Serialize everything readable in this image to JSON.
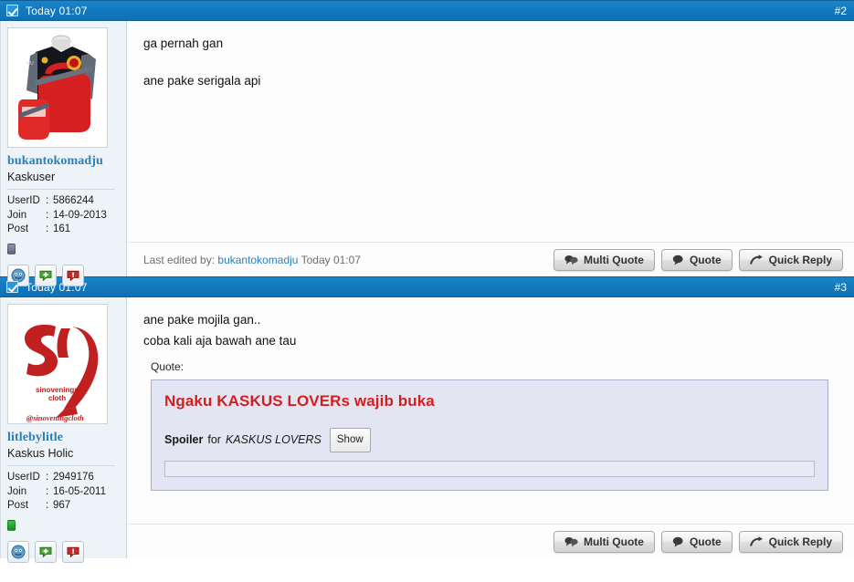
{
  "posts": [
    {
      "header": {
        "date": "Today 01:07",
        "number": "#2",
        "checkbox_icon": "checkbox-checked-icon"
      },
      "user": {
        "name": "bukantokomadju",
        "title": "Kaskuser",
        "avatar_alt": "manchester-united-jacket-avatar",
        "status": "offline",
        "stats": [
          {
            "key": "UserID",
            "sep": ":",
            "value": "5866244"
          },
          {
            "key": "Join",
            "sep": ":",
            "value": "14-09-2013"
          },
          {
            "key": "Post",
            "sep": ":",
            "value": "161"
          }
        ],
        "icons": [
          "profile-icon",
          "reputation-up-icon",
          "report-icon"
        ]
      },
      "body": {
        "lines": [
          "ga pernah gan",
          "ane pake serigala api"
        ]
      },
      "footer": {
        "last_edited_prefix": "Last edited by:",
        "last_edited_user": "bukantokomadju",
        "last_edited_time": "Today 01:07",
        "buttons": [
          {
            "label": "Multi Quote",
            "icon": "multi-quote-icon"
          },
          {
            "label": "Quote",
            "icon": "quote-icon"
          },
          {
            "label": "Quick Reply",
            "icon": "quick-reply-icon"
          }
        ]
      }
    },
    {
      "header": {
        "date": "Today 01:07",
        "number": "#3",
        "checkbox_icon": "checkbox-checked-icon"
      },
      "user": {
        "name": "litlebylitle",
        "title": "Kaskus Holic",
        "avatar_alt": "sin-sinovenings-cloth-logo-avatar",
        "avatar_caption": "sinovenings cloth",
        "avatar_handle": "@sinoveningcloth",
        "avatar_wordmark": "sin",
        "status": "online",
        "stats": [
          {
            "key": "UserID",
            "sep": ":",
            "value": "2949176"
          },
          {
            "key": "Join",
            "sep": ":",
            "value": "16-05-2011"
          },
          {
            "key": "Post",
            "sep": ":",
            "value": "967"
          }
        ],
        "icons": [
          "profile-icon",
          "reputation-up-icon",
          "report-icon"
        ]
      },
      "body": {
        "lines": [
          "ane pake mojila gan..",
          "coba kali aja bawah ane tau"
        ],
        "quote": {
          "label": "Quote:",
          "title": "Ngaku KASKUS LOVERs wajib buka",
          "spoiler_word": "Spoiler",
          "spoiler_for": "for",
          "spoiler_name": "KASKUS LOVERS",
          "show_button": "Show"
        }
      },
      "footer": {
        "buttons": [
          {
            "label": "Multi Quote",
            "icon": "multi-quote-icon"
          },
          {
            "label": "Quote",
            "icon": "quote-icon"
          },
          {
            "label": "Quick Reply",
            "icon": "quick-reply-icon"
          }
        ]
      }
    }
  ],
  "colors": {
    "header_blue": "#1479bd",
    "link_blue": "#2d7fb8",
    "quote_red": "#d31f1f",
    "sidebar_bg": "#eef3f7",
    "quote_bg": "#e3e5f2"
  }
}
